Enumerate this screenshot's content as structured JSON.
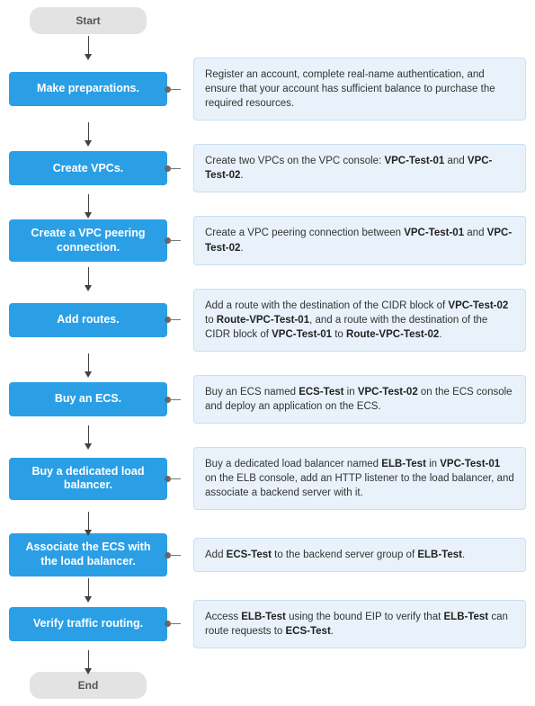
{
  "terminators": {
    "start": "Start",
    "end": "End"
  },
  "steps": [
    {
      "label": "Make preparations.",
      "desc": "Register an account, complete real-name authentication, and ensure that your account has sufficient balance to purchase the required resources.",
      "bold_terms": []
    },
    {
      "label": "Create VPCs.",
      "desc": "Create two VPCs on the VPC console: VPC-Test-01 and VPC-Test-02.",
      "bold_terms": [
        "VPC-Test-01",
        "VPC-Test-02"
      ]
    },
    {
      "label": "Create a VPC peering connection.",
      "desc": "Create a VPC peering connection between VPC-Test-01 and VPC-Test-02.",
      "bold_terms": [
        "VPC-Test-01",
        "VPC-Test-02"
      ]
    },
    {
      "label": "Add routes.",
      "desc": "Add a route with the destination of the CIDR block of VPC-Test-02 to Route-VPC-Test-01, and a route with the destination of the CIDR block of VPC-Test-01 to Route-VPC-Test-02.",
      "bold_terms": [
        "VPC-Test-02",
        "Route-VPC-Test-01",
        "VPC-Test-01",
        "Route-VPC-Test-02"
      ]
    },
    {
      "label": "Buy an ECS.",
      "desc": "Buy an ECS named ECS-Test in VPC-Test-02 on the ECS console and deploy an application on the ECS.",
      "bold_terms": [
        "ECS-Test",
        "VPC-Test-02"
      ]
    },
    {
      "label": "Buy a dedicated load balancer.",
      "desc": "Buy a dedicated load balancer named ELB-Test in VPC-Test-01 on the ELB console, add an HTTP listener to the load balancer, and associate a backend server with it.",
      "bold_terms": [
        "ELB-Test",
        "VPC-Test-01"
      ]
    },
    {
      "label": "Associate the ECS with the load balancer.",
      "desc": "Add ECS-Test to the backend server group of ELB-Test.",
      "bold_terms": [
        "ECS-Test",
        "ELB-Test"
      ]
    },
    {
      "label": "Verify traffic routing.",
      "desc": "Access ELB-Test using the bound EIP to verify that ELB-Test can route requests to ECS-Test.",
      "bold_terms": [
        "ELB-Test",
        "ELB-Test",
        "ECS-Test"
      ]
    }
  ]
}
